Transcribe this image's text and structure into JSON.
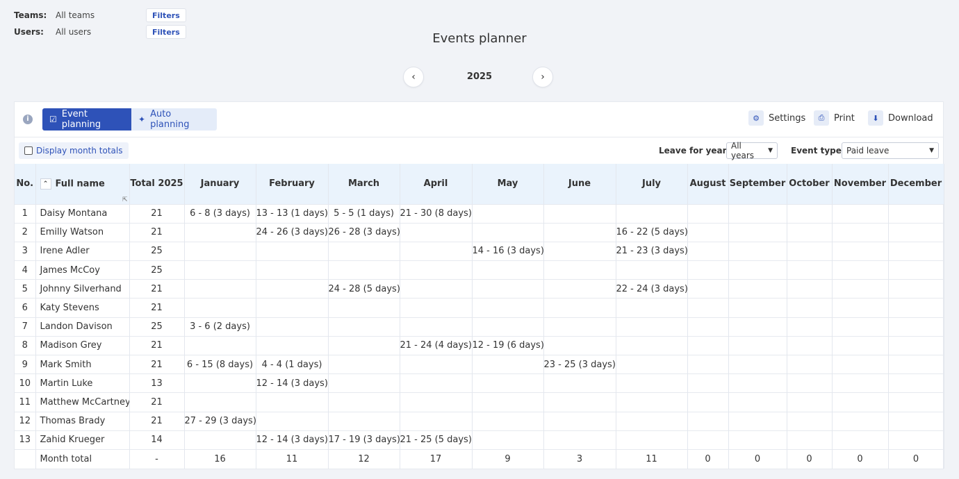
{
  "filters": {
    "teams_label": "Teams:",
    "teams_value": "All teams",
    "users_label": "Users:",
    "users_value": "All users",
    "button_label": "Filters"
  },
  "title": "Events planner",
  "year": "2025",
  "toolbar": {
    "tab_event_planning": "Event planning",
    "tab_auto_planning": "Auto planning",
    "settings": "Settings",
    "print": "Print",
    "download": "Download"
  },
  "subbar": {
    "display_month_totals": "Display month totals",
    "leave_for_year_label": "Leave for year",
    "leave_for_year_value": "All years",
    "event_type_label": "Event type",
    "event_type_value": "Paid leave"
  },
  "table": {
    "headers": [
      "No.",
      "Full name",
      "Total 2025",
      "January",
      "February",
      "March",
      "April",
      "May",
      "June",
      "July",
      "August",
      "September",
      "October",
      "November",
      "December"
    ],
    "rows": [
      [
        "1",
        "Daisy Montana",
        "21",
        "6 - 8 (3 days)",
        "13 - 13 (1 days)",
        "5 - 5 (1 days)",
        "21 - 30 (8 days)",
        "",
        "",
        "",
        "",
        "",
        "",
        "",
        ""
      ],
      [
        "2",
        "Emilly Watson",
        "21",
        "",
        "24 - 26 (3 days)",
        "26 - 28 (3 days)",
        "",
        "",
        "",
        "16 - 22 (5 days)",
        "",
        "",
        "",
        "",
        ""
      ],
      [
        "3",
        "Irene Adler",
        "25",
        "",
        "",
        "",
        "",
        "14 - 16 (3 days)",
        "",
        "21 - 23 (3 days)",
        "",
        "",
        "",
        "",
        ""
      ],
      [
        "4",
        "James McCoy",
        "25",
        "",
        "",
        "",
        "",
        "",
        "",
        "",
        "",
        "",
        "",
        "",
        ""
      ],
      [
        "5",
        "Johnny Silverhand",
        "21",
        "",
        "",
        "24 - 28 (5 days)",
        "",
        "",
        "",
        "22 - 24 (3 days)",
        "",
        "",
        "",
        "",
        ""
      ],
      [
        "6",
        "Katy Stevens",
        "21",
        "",
        "",
        "",
        "",
        "",
        "",
        "",
        "",
        "",
        "",
        "",
        ""
      ],
      [
        "7",
        "Landon Davison",
        "25",
        "3 - 6 (2 days)",
        "",
        "",
        "",
        "",
        "",
        "",
        "",
        "",
        "",
        "",
        ""
      ],
      [
        "8",
        "Madison Grey",
        "21",
        "",
        "",
        "",
        "21 - 24 (4 days)",
        "12 - 19 (6 days)",
        "",
        "",
        "",
        "",
        "",
        "",
        ""
      ],
      [
        "9",
        "Mark Smith",
        "21",
        "6 - 15 (8 days)",
        "4 - 4 (1 days)",
        "",
        "",
        "",
        "23 - 25 (3 days)",
        "",
        "",
        "",
        "",
        "",
        ""
      ],
      [
        "10",
        "Martin Luke",
        "13",
        "",
        "12 - 14 (3 days)",
        "",
        "",
        "",
        "",
        "",
        "",
        "",
        "",
        "",
        ""
      ],
      [
        "11",
        "Matthew McCartney",
        "21",
        "",
        "",
        "",
        "",
        "",
        "",
        "",
        "",
        "",
        "",
        "",
        ""
      ],
      [
        "12",
        "Thomas Brady",
        "21",
        "27 - 29 (3 days)",
        "",
        "",
        "",
        "",
        "",
        "",
        "",
        "",
        "",
        "",
        ""
      ],
      [
        "13",
        "Zahid Krueger",
        "14",
        "",
        "12 - 14 (3 days)",
        "17 - 19 (3 days)",
        "21 - 25 (5 days)",
        "",
        "",
        "",
        "",
        "",
        "",
        "",
        ""
      ]
    ],
    "total_row": [
      "",
      "Month total",
      "-",
      "16",
      "11",
      "12",
      "17",
      "9",
      "3",
      "11",
      "0",
      "0",
      "0",
      "0",
      "0"
    ]
  },
  "colors": {
    "accent": "#2e52b8",
    "header_bg": "#eaf3fc",
    "page_bg": "#f1f3f7"
  }
}
